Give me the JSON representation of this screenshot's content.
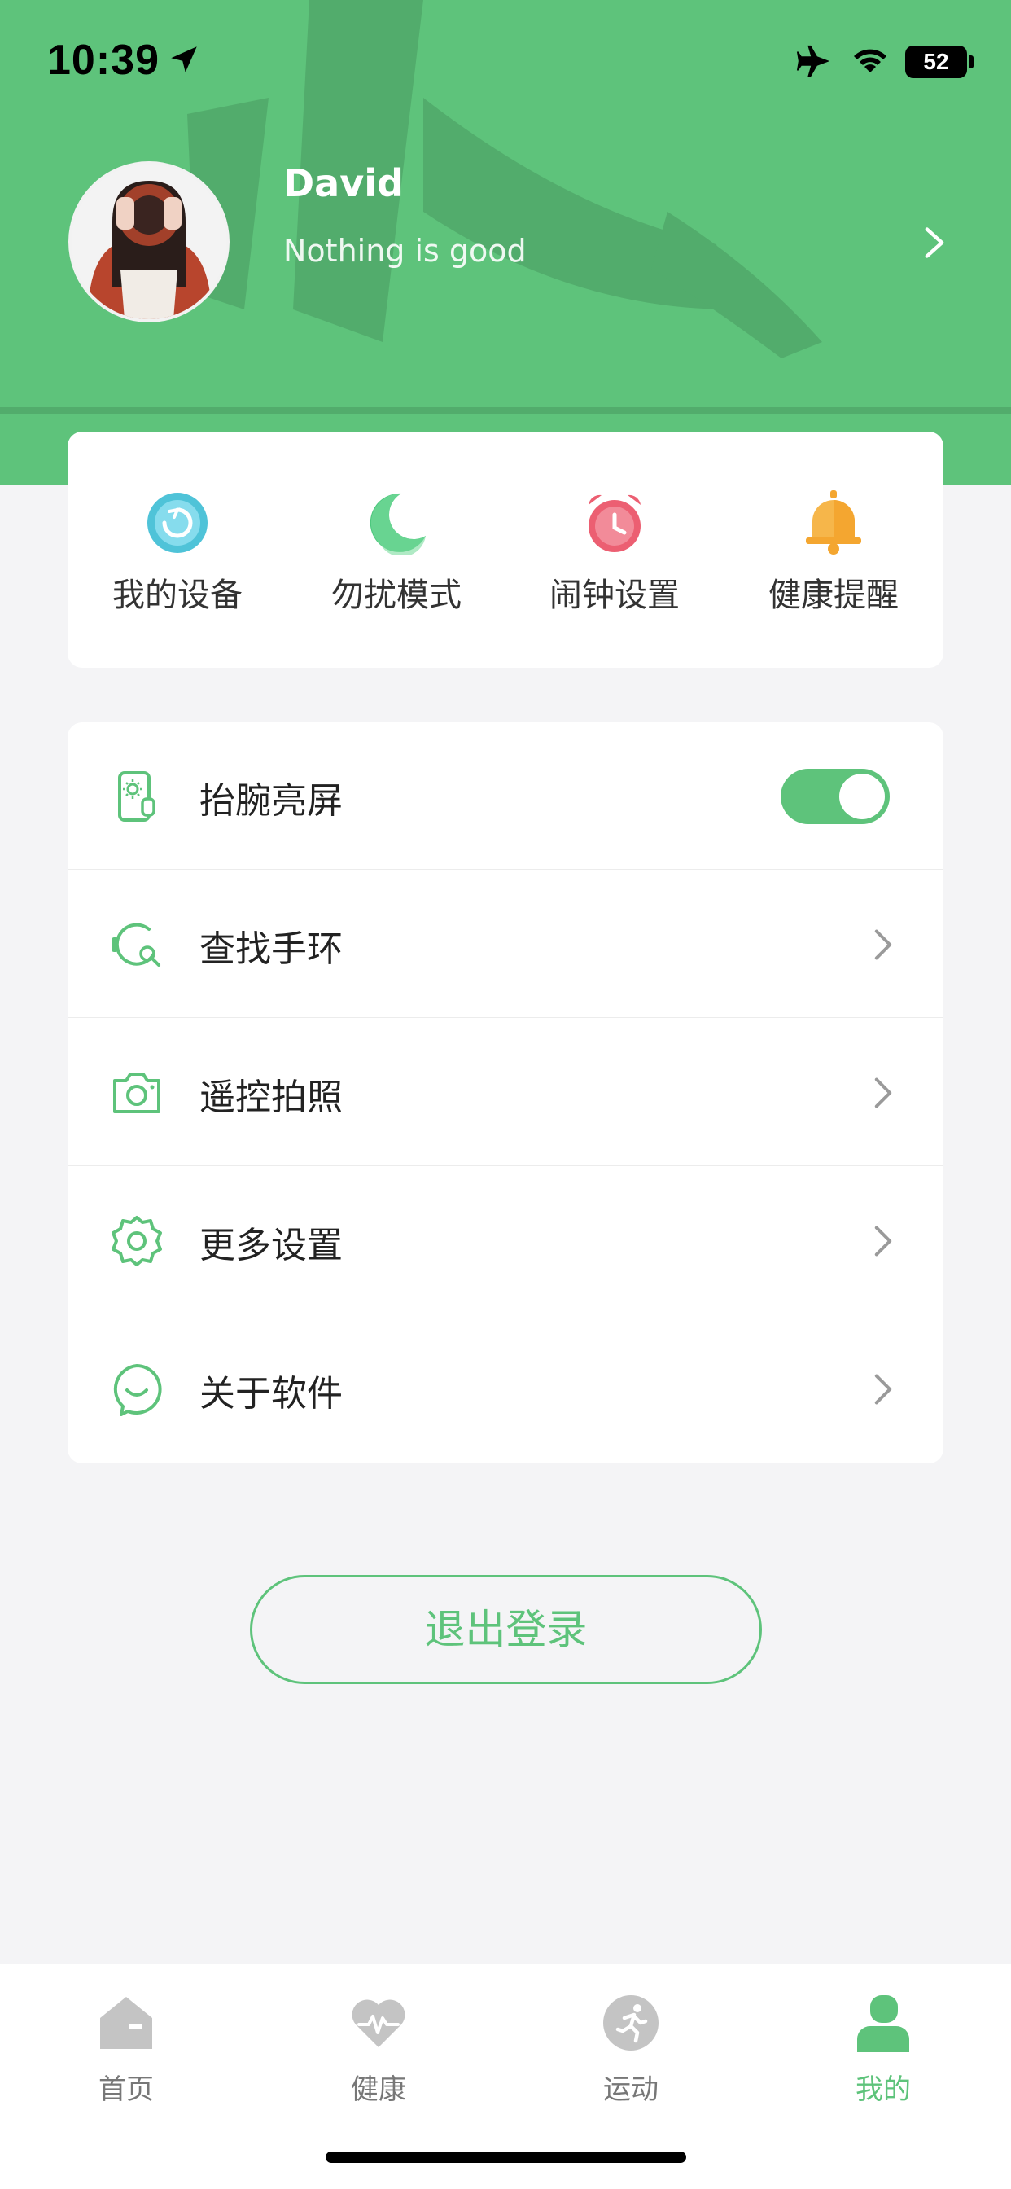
{
  "status_bar": {
    "time": "10:39",
    "battery": "52",
    "icons": [
      "location-arrow-icon",
      "airplane-icon",
      "wifi-icon",
      "battery-icon"
    ]
  },
  "profile": {
    "name": "David",
    "bio": "Nothing is good"
  },
  "quick_actions": [
    {
      "label": "我的设备",
      "icon": "device-icon",
      "color": "#4fc3d8"
    },
    {
      "label": "勿扰模式",
      "icon": "moon-icon",
      "color": "#4cc77d"
    },
    {
      "label": "闹钟设置",
      "icon": "alarm-clock-icon",
      "color": "#ec5f72"
    },
    {
      "label": "健康提醒",
      "icon": "bell-icon",
      "color": "#f4a630"
    }
  ],
  "settings": [
    {
      "label": "抬腕亮屏",
      "icon": "raise-wrist-icon",
      "control": "toggle",
      "on": true
    },
    {
      "label": "查找手环",
      "icon": "find-band-icon",
      "control": "chevron"
    },
    {
      "label": "遥控拍照",
      "icon": "camera-icon",
      "control": "chevron"
    },
    {
      "label": "更多设置",
      "icon": "gear-icon",
      "control": "chevron"
    },
    {
      "label": "关于软件",
      "icon": "about-icon",
      "control": "chevron"
    }
  ],
  "logout_label": "退出登录",
  "tabs": [
    {
      "label": "首页",
      "icon": "home-icon",
      "active": false
    },
    {
      "label": "健康",
      "icon": "heart-pulse-icon",
      "active": false
    },
    {
      "label": "运动",
      "icon": "running-icon",
      "active": false
    },
    {
      "label": "我的",
      "icon": "person-icon",
      "active": true
    }
  ],
  "colors": {
    "accent": "#5ec37b",
    "background": "#f4f4f6",
    "card": "#ffffff",
    "inactive_tab": "#c4c4c4"
  }
}
